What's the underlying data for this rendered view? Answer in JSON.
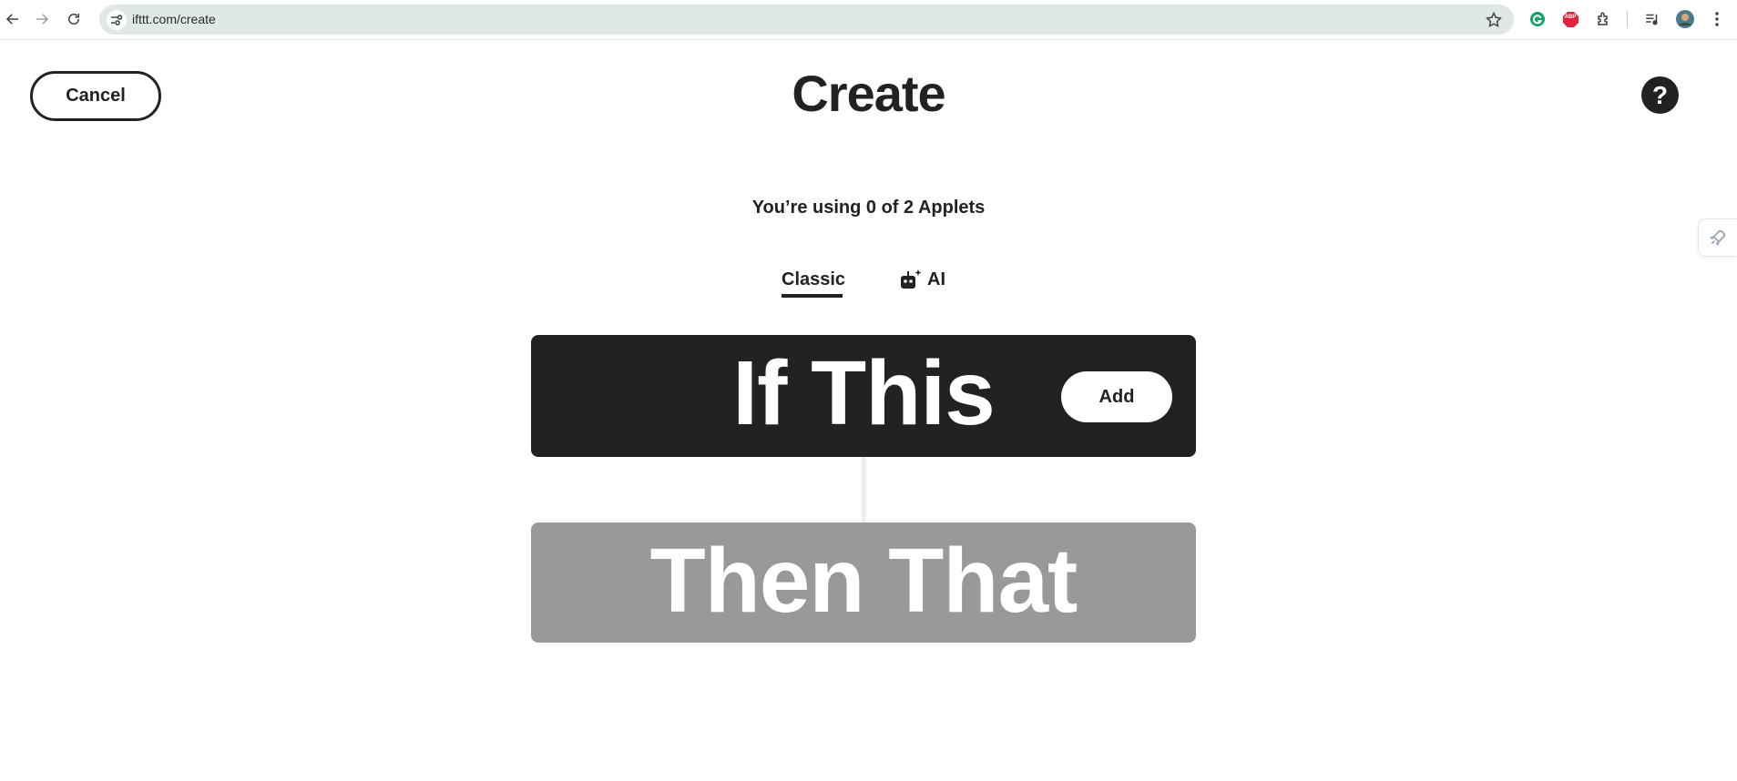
{
  "browser": {
    "url": "ifttt.com/create",
    "icons": [
      "back-arrow-icon",
      "forward-arrow-icon",
      "reload-icon",
      "site-settings-icon",
      "bookmark-star-icon",
      "grammarly-icon",
      "adblock-plus-icon",
      "extensions-puzzle-icon",
      "media-controls-icon",
      "profile-avatar",
      "more-menu-icon"
    ],
    "adblock_label": "ABP"
  },
  "header": {
    "cancel_label": "Cancel",
    "title": "Create",
    "help_label": "?"
  },
  "usage_text": "You’re using 0 of 2 Applets",
  "tabs": {
    "classic_label": "Classic",
    "ai_label": "AI"
  },
  "builder": {
    "if_label": "If This",
    "add_label": "Add",
    "then_label": "Then That"
  },
  "colors": {
    "if_card": "#222222",
    "then_card": "#999999",
    "omnibox": "#dfe7e7"
  }
}
